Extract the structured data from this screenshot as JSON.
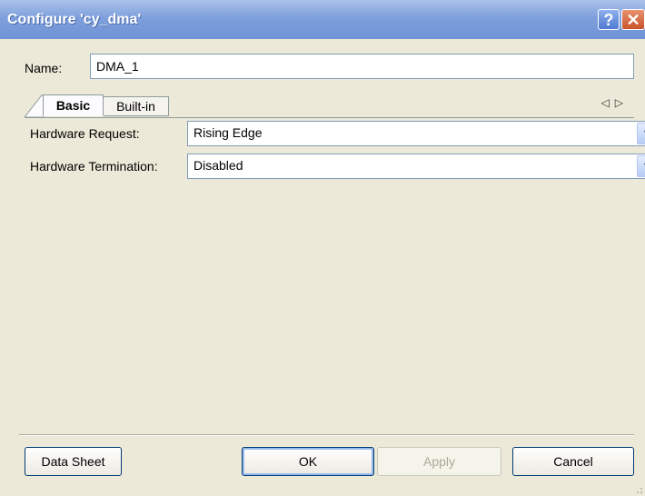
{
  "window": {
    "title": "Configure 'cy_dma'"
  },
  "titlebar": {
    "help_label": "?",
    "close_label": "✕"
  },
  "name": {
    "label": "Name:",
    "value": "DMA_1"
  },
  "tabs": [
    {
      "label": "Basic",
      "active": true
    },
    {
      "label": "Built-in",
      "active": false
    }
  ],
  "tab_scroll": {
    "left": "◁",
    "right": "▷"
  },
  "fields": [
    {
      "label": "Hardware Request:",
      "value": "Rising Edge"
    },
    {
      "label": "Hardware Termination:",
      "value": "Disabled"
    }
  ],
  "buttons": {
    "datasheet": "Data Sheet",
    "ok": "OK",
    "apply": "Apply",
    "cancel": "Cancel"
  },
  "colors": {
    "titlebar": "#7ea0dc",
    "dialog_bg": "#ece9d8",
    "input_border": "#7f9db9"
  }
}
